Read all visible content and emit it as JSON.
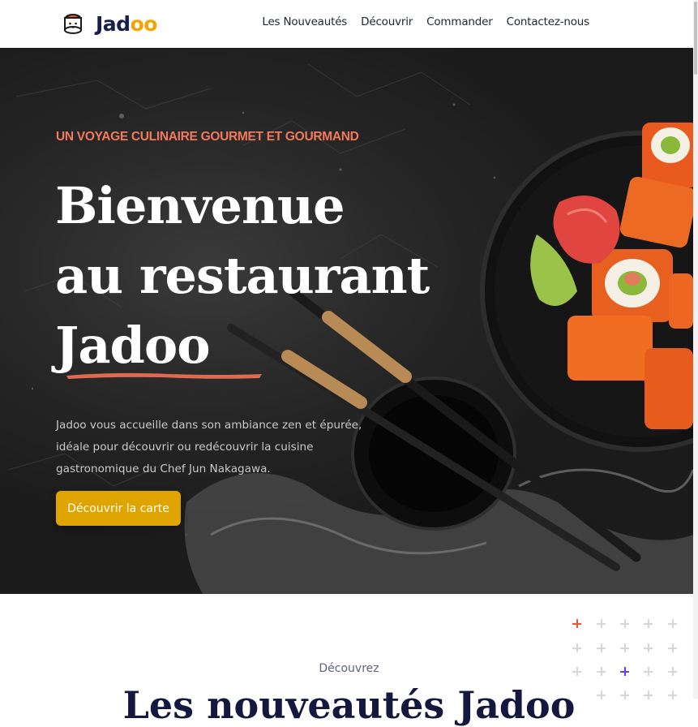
{
  "header": {
    "brand": {
      "name_main": "Jad",
      "name_accent": "oo",
      "logo_icon": "sushi-chef-icon"
    },
    "nav": [
      {
        "label": "Les Nouveautés"
      },
      {
        "label": "Découvrir"
      },
      {
        "label": "Commander"
      },
      {
        "label": "Contactez-nous"
      }
    ]
  },
  "hero": {
    "eyebrow": "UN VOYAGE CULINAIRE GOURMET ET GOURMAND",
    "headline": [
      "Bienvenue",
      "au restaurant",
      "Jadoo"
    ],
    "lede": "Jadoo vous accueille dans son ambiance zen et épurée, idéale pour découvrir ou redécouvrir la cuisine gastronomique du Chef Jun Nakagawa.",
    "cta_label": "Découvrir la carte"
  },
  "section": {
    "eyebrow": "Découvrez",
    "title": "Les nouveautés Jadoo"
  },
  "colors": {
    "accent_orange": "#f27a5a",
    "cta_gold": "#dfa400",
    "brand_yellow": "#f1a501",
    "navy": "#14183e",
    "plus_orange": "#f2562e",
    "plus_purple": "#6a3cf0",
    "plus_gray": "#d6d6d6"
  }
}
